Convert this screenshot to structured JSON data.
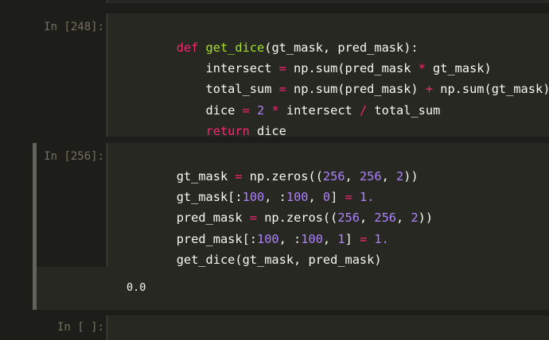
{
  "cells": [
    {
      "prompt": "In [248]:",
      "lines": [
        [
          "def",
          " ",
          "get_dice",
          "(gt_mask, pred_mask):"
        ],
        [
          "    intersect ",
          "=",
          " np.sum(pred_mask ",
          "*",
          " gt_mask)"
        ],
        [
          "    total_sum ",
          "=",
          " np.sum(pred_mask) ",
          "+",
          " np.sum(gt_mask)"
        ],
        [
          "    dice ",
          "=",
          " ",
          "2",
          " ",
          "*",
          " intersect ",
          "/",
          " total_sum"
        ],
        [
          "    ",
          "return",
          " dice"
        ]
      ]
    },
    {
      "prompt": "In [256]:",
      "lines": [
        [
          "gt_mask ",
          "=",
          " np.zeros((",
          "256",
          ", ",
          "256",
          ", ",
          "2",
          "))"
        ],
        [
          "gt_mask[:",
          "100",
          ", :",
          "100",
          ", ",
          "0",
          "] ",
          "=",
          " ",
          "1.",
          ""
        ],
        [
          "pred_mask ",
          "=",
          " np.zeros((",
          "256",
          ", ",
          "256",
          ", ",
          "2",
          "))"
        ],
        [
          "pred_mask[:",
          "100",
          ", :",
          "100",
          ", ",
          "1",
          "] ",
          "=",
          " ",
          "1.",
          ""
        ],
        [
          "get_dice(gt_mask, pred_mask)"
        ]
      ],
      "output": "0.0"
    },
    {
      "prompt": "In [ ]:"
    }
  ],
  "colors": {
    "background": "#1d1e1a",
    "cell_background": "#272822",
    "prompt": "#75715e",
    "text": "#f8f8f2",
    "keyword": "#f92672",
    "function_name": "#a6e22e",
    "number": "#ae81ff",
    "selected_cell_bar": "#616459"
  }
}
